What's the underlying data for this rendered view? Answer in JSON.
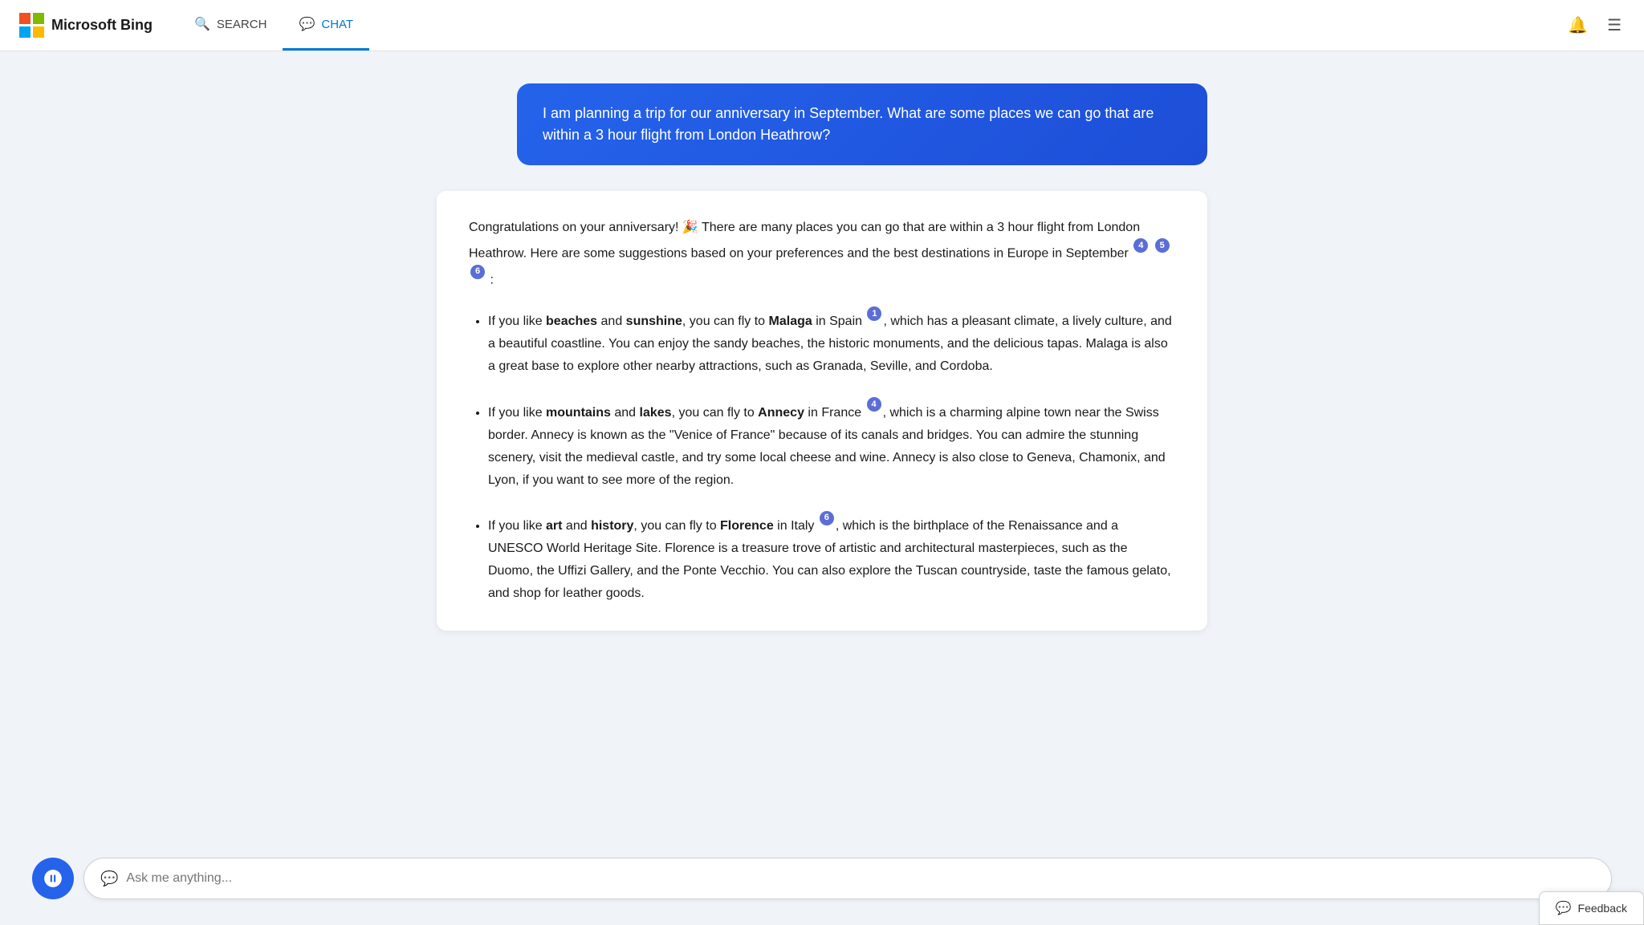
{
  "header": {
    "logo_text": "Microsoft Bing",
    "nav_search_label": "SEARCH",
    "nav_chat_label": "CHAT",
    "notification_icon": "bell",
    "menu_icon": "hamburger"
  },
  "user_message": "I am planning a trip for our anniversary in September. What are some places we can go that are within a 3 hour flight from London Heathrow?",
  "ai_response": {
    "intro": "Congratulations on your anniversary! 🎉 There are many places you can go that are within a 3 hour flight from London Heathrow. Here are some suggestions based on your preferences and the best destinations in Europe in September",
    "intro_citations": [
      "4",
      "5",
      "6"
    ],
    "items": [
      {
        "prefix": "If you like ",
        "bold1": "beaches",
        "connector1": " and ",
        "bold2": "sunshine",
        "suffix_before_dest": ", you can fly to ",
        "destination": "Malaga",
        "suffix_after_dest": " in Spain",
        "citation": "1",
        "rest": ", which has a pleasant climate, a lively culture, and a beautiful coastline. You can enjoy the sandy beaches, the historic monuments, and the delicious tapas. Malaga is also a great base to explore other nearby attractions, such as Granada, Seville, and Cordoba."
      },
      {
        "prefix": "If you like ",
        "bold1": "mountains",
        "connector1": " and ",
        "bold2": "lakes",
        "suffix_before_dest": ", you can fly to ",
        "destination": "Annecy",
        "suffix_after_dest": " in France",
        "citation": "4",
        "rest": ", which is a charming alpine town near the Swiss border. Annecy is known as the \"Venice of France\" because of its canals and bridges. You can admire the stunning scenery, visit the medieval castle, and try some local cheese and wine. Annecy is also close to Geneva, Chamonix, and Lyon, if you want to see more of the region."
      },
      {
        "prefix": "If you like ",
        "bold1": "art",
        "connector1": " and ",
        "bold2": "history",
        "suffix_before_dest": ", you can fly to ",
        "destination": "Florence",
        "suffix_after_dest": " in Italy",
        "citation": "6",
        "rest": ", which is the birthplace of the Renaissance and a UNESCO World Heritage Site. Florence is a treasure trove of artistic and architectural masterpieces, such as the Duomo, the Uffizi Gallery, and the Ponte Vecchio. You can also explore the Tuscan countryside, taste the famous gelato, and shop for leather goods."
      }
    ]
  },
  "input": {
    "placeholder": "Ask me anything..."
  },
  "feedback": {
    "label": "Feedback"
  }
}
